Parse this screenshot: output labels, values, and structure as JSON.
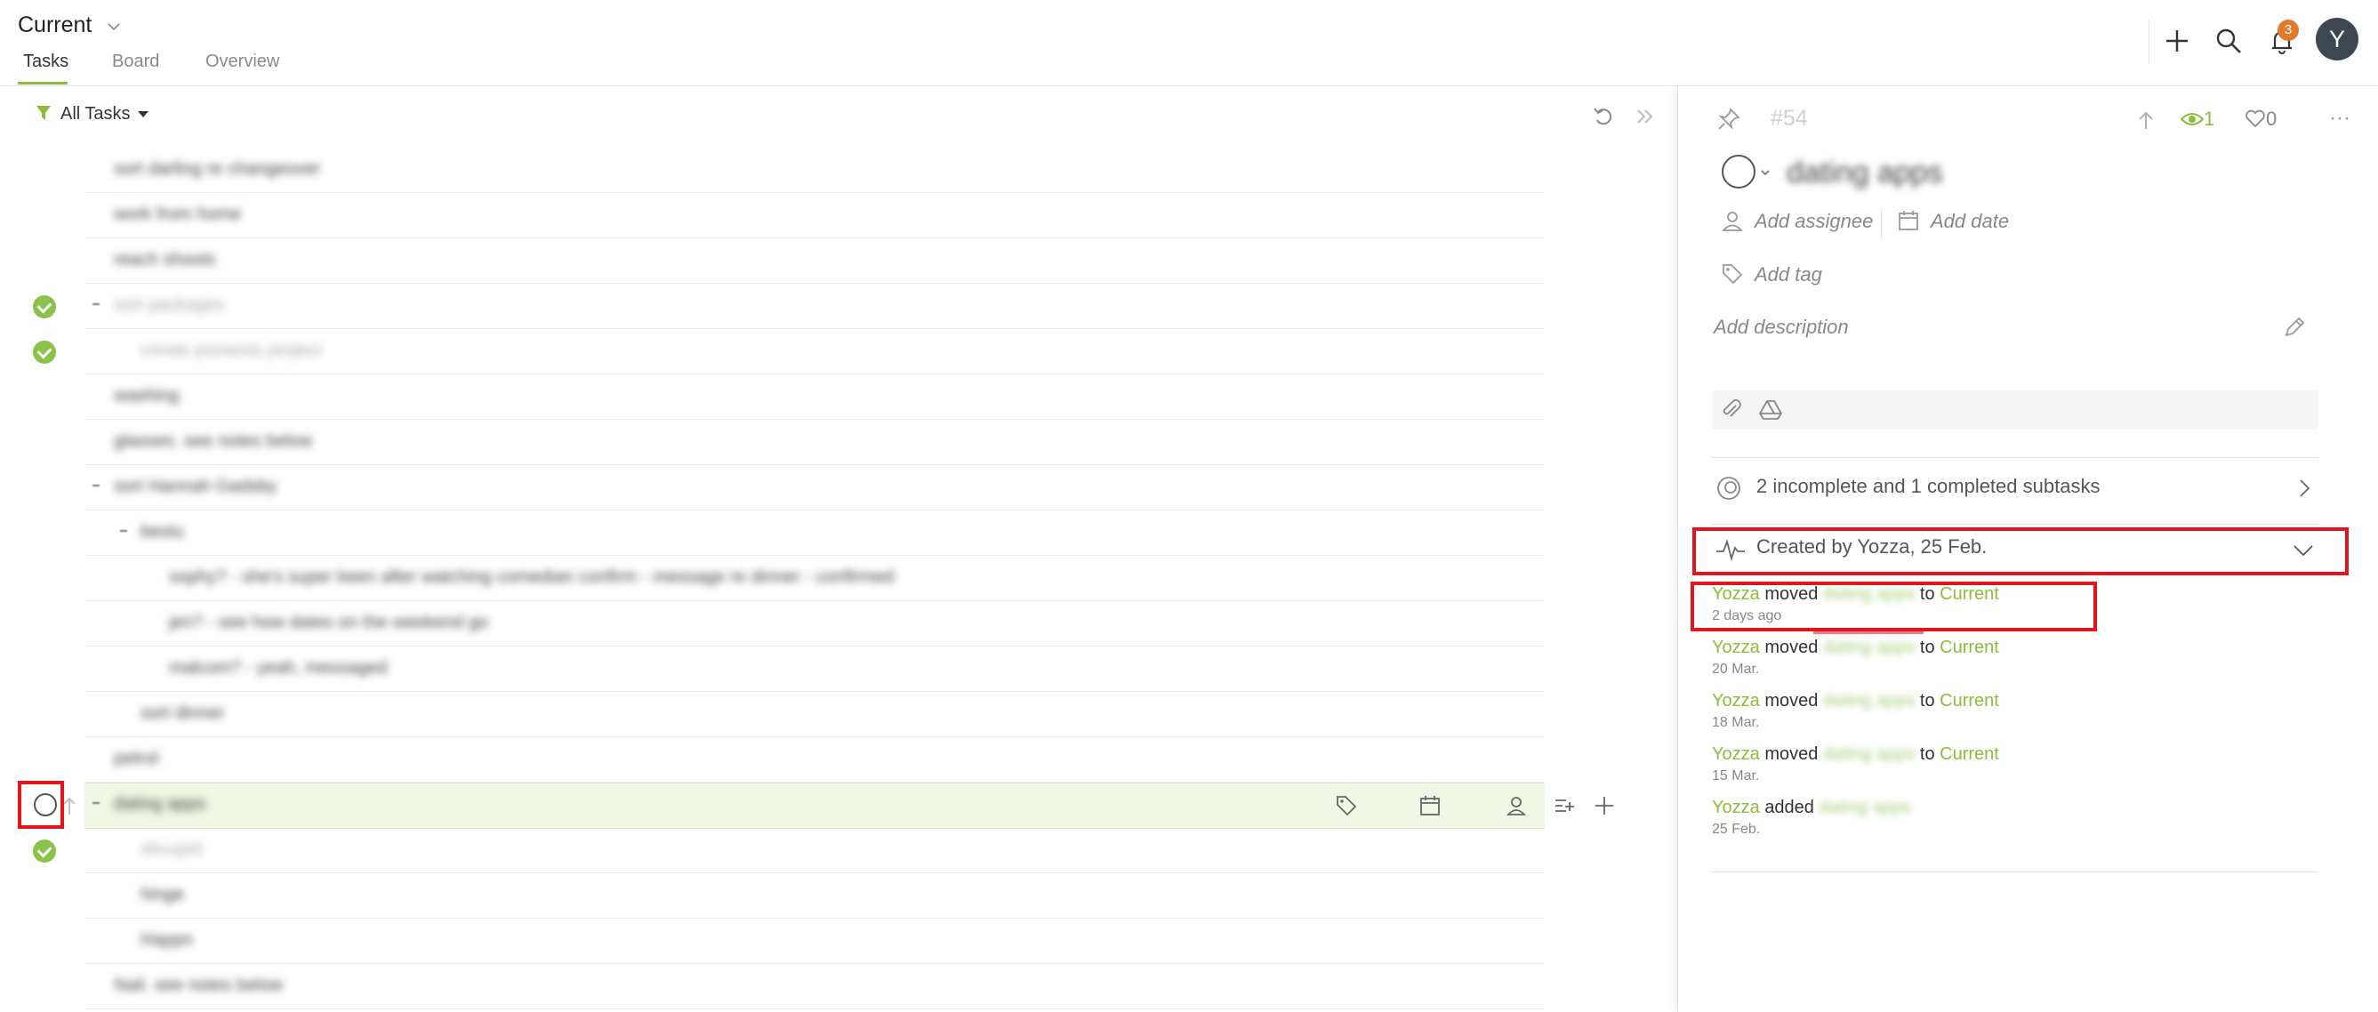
{
  "header": {
    "project_title": "Current",
    "tabs": [
      {
        "label": "Tasks",
        "active": true
      },
      {
        "label": "Board",
        "active": false
      },
      {
        "label": "Overview",
        "active": false
      }
    ],
    "notification_count": "3",
    "avatar_initial": "Y"
  },
  "task_list": {
    "filter_label": "All Tasks",
    "rows": [
      {
        "text": "sort darling re changeover",
        "done": false
      },
      {
        "text": "work from home",
        "done": false
      },
      {
        "text": "reach shoots",
        "done": false
      },
      {
        "text": "sort packages",
        "done": true
      },
      {
        "text": "create presents project",
        "done": true
      },
      {
        "text": "washing",
        "done": false
      },
      {
        "text": "glasses. see notes below",
        "done": false
      },
      {
        "text": "sort Hannah Gadsby",
        "done": false
      },
      {
        "text": "bestu",
        "done": false
      },
      {
        "text": "sophy? - she's super keen after watching comedian confirm - message re dinner - confirmed",
        "done": false
      },
      {
        "text": "jen? - see how dates on the weekend go",
        "done": false
      },
      {
        "text": "malcom? - yeah, messaged",
        "done": false
      },
      {
        "text": "sort dinner",
        "done": false
      },
      {
        "text": "petrol",
        "done": false
      },
      {
        "text": "dating apps",
        "done": false,
        "selected": true
      },
      {
        "text": "okcupid",
        "done": true
      },
      {
        "text": "hinge",
        "done": false
      },
      {
        "text": "Happn",
        "done": false
      },
      {
        "text": "Nail. see notes below",
        "done": false
      }
    ]
  },
  "detail": {
    "task_number": "#54",
    "title": "dating apps",
    "watchers": "1",
    "likes": "0",
    "add_assignee": "Add assignee",
    "add_date": "Add date",
    "add_tag": "Add tag",
    "add_description": "Add description",
    "subtasks_summary": "2 incomplete and 1 completed subtasks",
    "created_by": "Created by Yozza, 25 Feb.",
    "activity": [
      {
        "user": "Yozza",
        "verb": "moved",
        "task": "dating apps",
        "prep": "to",
        "dest": "Current",
        "when": "2 days ago"
      },
      {
        "user": "Yozza",
        "verb": "moved",
        "task": "dating apps",
        "prep": "to",
        "dest": "Current",
        "when": "20 Mar."
      },
      {
        "user": "Yozza",
        "verb": "moved",
        "task": "dating apps",
        "prep": "to",
        "dest": "Current",
        "when": "18 Mar."
      },
      {
        "user": "Yozza",
        "verb": "moved",
        "task": "dating apps",
        "prep": "to",
        "dest": "Current",
        "when": "15 Mar."
      },
      {
        "user": "Yozza",
        "verb": "added",
        "task": "dating apps",
        "prep": "",
        "dest": "",
        "when": "25 Feb."
      }
    ]
  },
  "colors": {
    "accent": "#8bbd3a",
    "badge": "#e07b2e",
    "highlight_box": "#e3141b",
    "avatar_bg": "#3d474f"
  }
}
